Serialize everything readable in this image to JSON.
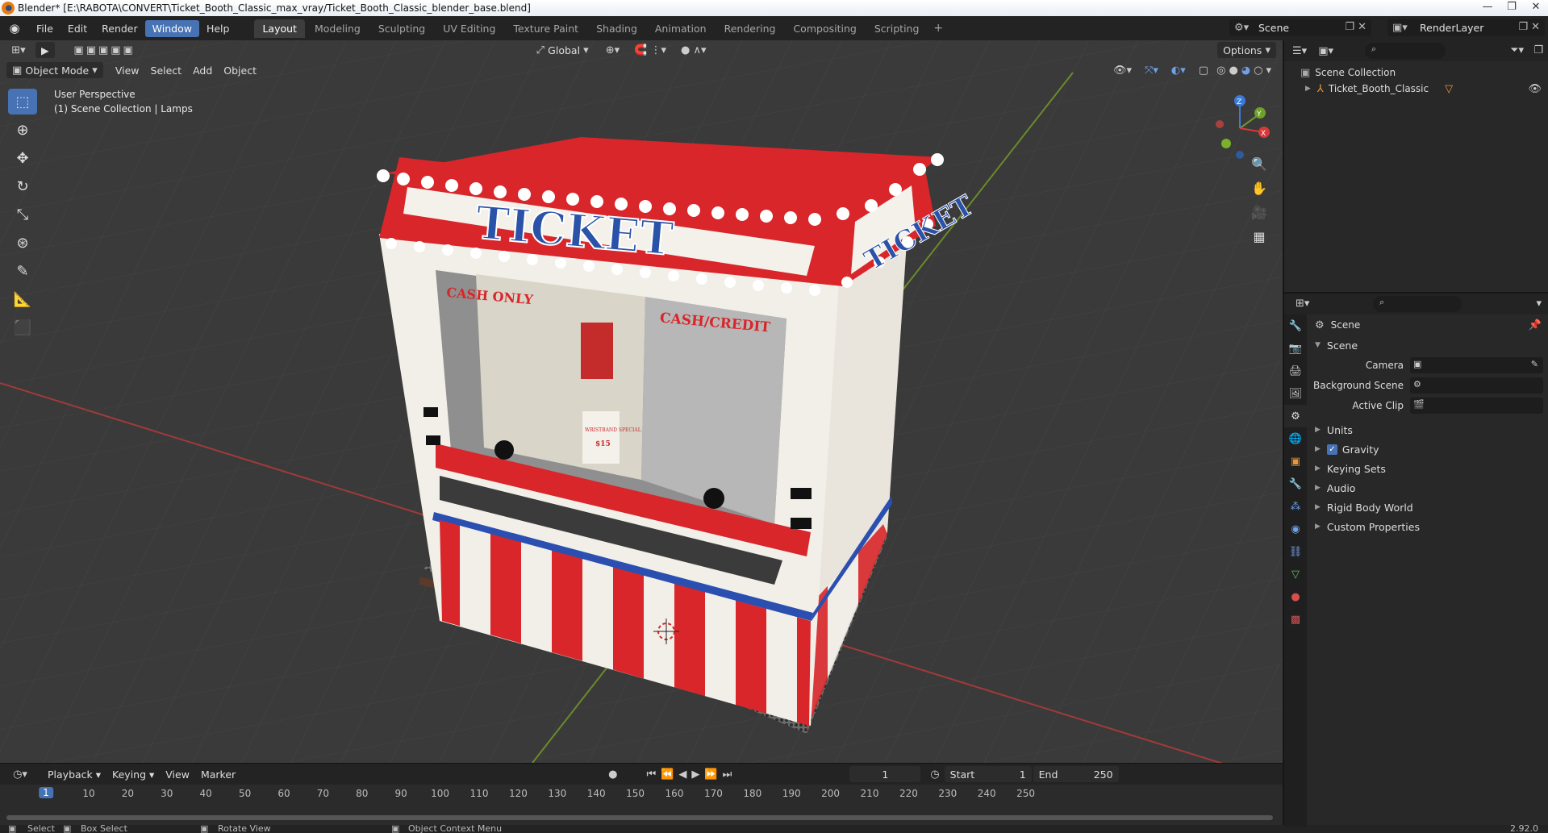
{
  "window": {
    "title": "Blender* [E:\\RABOTA\\CONVERT\\Ticket_Booth_Classic_max_vray/Ticket_Booth_Classic_blender_base.blend]",
    "controls": [
      "—",
      "❐",
      "✕"
    ]
  },
  "menus": [
    "File",
    "Edit",
    "Render",
    "Window",
    "Help"
  ],
  "active_menu": "Window",
  "workspaces": [
    "Layout",
    "Modeling",
    "Sculpting",
    "UV Editing",
    "Texture Paint",
    "Shading",
    "Animation",
    "Rendering",
    "Compositing",
    "Scripting"
  ],
  "active_workspace": "Layout",
  "scene_selector": "Scene",
  "renderlayer_selector": "RenderLayer",
  "viewport": {
    "transform_orientation": "Global",
    "options_label": "Options",
    "mode": "Object Mode",
    "header_menus": [
      "View",
      "Select",
      "Add",
      "Object"
    ],
    "info_line1": "User Perspective",
    "info_line2": "(1) Scene Collection | Lamps",
    "gizmo_axes": [
      "Z",
      "Y",
      "X"
    ]
  },
  "booth": {
    "sign_front": "TICKET",
    "sign_side": "TICKET",
    "cash_only": "CASH ONLY",
    "cash_credit": "CASH/CREDIT",
    "poster_small": "WRISTBAND SPECIAL",
    "poster_price": "$15"
  },
  "timeline": {
    "menus": [
      "Playback",
      "Keying",
      "View",
      "Marker"
    ],
    "current_frame": "1",
    "start_label": "Start",
    "start_value": "1",
    "end_label": "End",
    "end_value": "250",
    "ruler_ticks": [
      "10",
      "20",
      "30",
      "40",
      "50",
      "60",
      "70",
      "80",
      "90",
      "100",
      "110",
      "120",
      "130",
      "140",
      "150",
      "160",
      "170",
      "180",
      "190",
      "200",
      "210",
      "220",
      "230",
      "240",
      "250"
    ],
    "cursor_frame": "1"
  },
  "statusbar": {
    "select": "Select",
    "box_select": "Box Select",
    "rotate_view": "Rotate View",
    "context_menu": "Object Context Menu",
    "version": "2.92.0"
  },
  "outliner": {
    "root": "Scene Collection",
    "items": [
      "Ticket_Booth_Classic"
    ]
  },
  "properties": {
    "context": "Scene",
    "section": "Scene",
    "fields": [
      {
        "label": "Camera",
        "value": ""
      },
      {
        "label": "Background Scene",
        "value": ""
      },
      {
        "label": "Active Clip",
        "value": ""
      }
    ],
    "subpanels": [
      "Units",
      "Gravity",
      "Keying Sets",
      "Audio",
      "Rigid Body World",
      "Custom Properties"
    ],
    "gravity_checked": true
  },
  "colors": {
    "accent": "#4772b3",
    "booth_red": "#d8262a",
    "booth_white": "#f2efe9",
    "grid_x": "#a23a3a",
    "grid_y": "#6b8a2a"
  }
}
